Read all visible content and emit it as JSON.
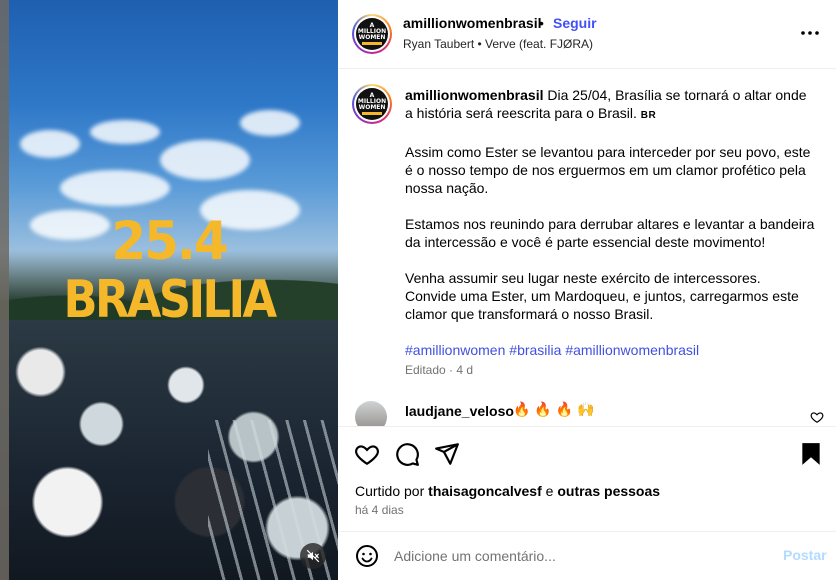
{
  "media": {
    "overlay_line1": "25.4",
    "overlay_line2": "BRASILIA",
    "mute_icon": "speaker-muted-icon"
  },
  "header": {
    "username": "amillionwomenbrasil",
    "separator": "•",
    "follow_label": "Seguir",
    "audio": "Ryan Taubert • Verve (feat. FJØRA)",
    "more_icon": "more-options-icon",
    "avatar_logo": [
      "A",
      "MILLION",
      "WOMEN",
      "BRASIL"
    ]
  },
  "caption": {
    "username": "amillionwomenbrasil",
    "p1": "Dia 25/04, Brasília se tornará o altar onde a história será reescrita para o Brasil.",
    "flag": "BR",
    "p2": "Assim como Ester se levantou para interceder por seu povo, este é o nosso tempo de nos erguermos em um clamor profético pela nossa nação.",
    "p3": "Estamos nos reunindo para derrubar altares e levantar a bandeira da intercessão e você é parte essencial deste movimento!",
    "p4": "Venha assumir seu lugar neste exército de intercessores. Convide uma Ester, um Mardoqueu, e juntos, carregarmos este clamor que transformará o nosso Brasil.",
    "hashtags": [
      "#amillionwomen",
      "#brasilia",
      "#amillionwomenbrasil"
    ],
    "edited": "Editado · 4 d"
  },
  "comment": {
    "username": "laudjane_veloso",
    "text": "🔥 🔥 🔥 🙌"
  },
  "actions": {
    "liked_prefix": "Curtido por",
    "liked_user": "thaisagoncalvesf",
    "liked_and": "e",
    "liked_others": "outras pessoas",
    "time": "há 4 dias"
  },
  "add_comment": {
    "placeholder": "Adicione um comentário...",
    "post_label": "Postar"
  },
  "colors": {
    "accent_link": "#4150f7",
    "post_disabled": "#b3dbff",
    "overlay_text": "#f5b82a"
  }
}
